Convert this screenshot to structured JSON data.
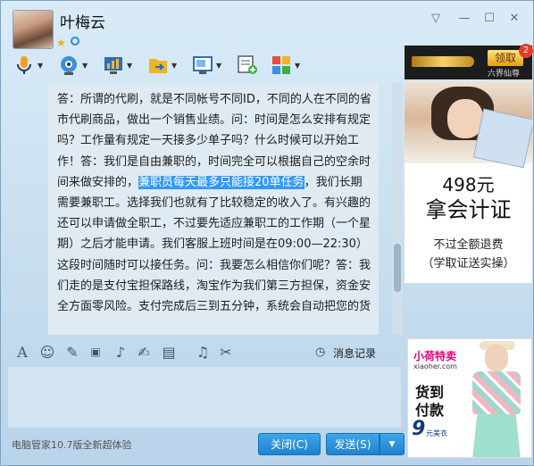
{
  "window": {
    "contact_name": "叶梅云",
    "controls": {
      "menu": "▽",
      "minimize": "—",
      "maximize": "☐",
      "close": "✕"
    }
  },
  "toolbar": {
    "items": [
      {
        "icon": "microphone-icon",
        "arrow": "▼"
      },
      {
        "icon": "webcam-icon",
        "arrow": "▼"
      },
      {
        "icon": "remote-desktop-icon",
        "arrow": "▼"
      },
      {
        "icon": "file-transfer-icon",
        "arrow": "▼"
      },
      {
        "icon": "screen-share-icon",
        "arrow": "▼"
      },
      {
        "icon": "add-discussion-icon"
      },
      {
        "icon": "app-grid-icon",
        "arrow": "▼"
      }
    ]
  },
  "chat": {
    "text_before": "答：所谓的代刷，就是不同帐号不同ID，不同的人在不同的省市代刷商品，做出一个销售业绩。问：时间是怎么安排有规定吗？工作量有规定一天接多少单子吗？什么时候可以开始工作！答：我们是自由兼职的，时间完全可以根据自己的空余时间来做安排的，",
    "highlighted": "兼职员每天最多只能接20单任务",
    "text_after": "，我们长期需要兼职工。选择我们也就有了比较稳定的收入了。有兴趣的还可以申请做全职工，不过要先适应兼职工的工作期（一个星期）之后才能申请。我们客服上班时间是在09:00—22:30）这段时间随时可以接任务。问：我要怎么相信你们呢？答：我们走的是支付宝担保路线，淘宝作为我们第三方担保，资金安全方面零风险。支付完成后三到五分钟，系统会自动把您的货"
  },
  "ads": {
    "top": {
      "button": "领取",
      "sub": "六界仙尊",
      "badge": "2"
    },
    "middle": {
      "price": "498元",
      "title": "拿会计证",
      "line1": "不过全额退费",
      "line2": "（学取证送实操）"
    },
    "bottom": {
      "brand": "小荷特卖",
      "site": "xiaoher.com",
      "big1": "货到",
      "big2": "付款",
      "nine": "9",
      "nine_sub": "元美衣"
    }
  },
  "input_toolbar": {
    "icons": [
      "font-icon",
      "emoji-icon",
      "shake-icon",
      "gif-icon",
      "voice-icon",
      "edit-icon",
      "image-icon",
      "music-icon",
      "scissors-icon"
    ],
    "history_label": "消息记录"
  },
  "bottom": {
    "status": "电脑管家10.7版全新超体验",
    "close_label": "关闭(C)",
    "send_label": "发送(S)",
    "send_dropdown": "▼"
  }
}
